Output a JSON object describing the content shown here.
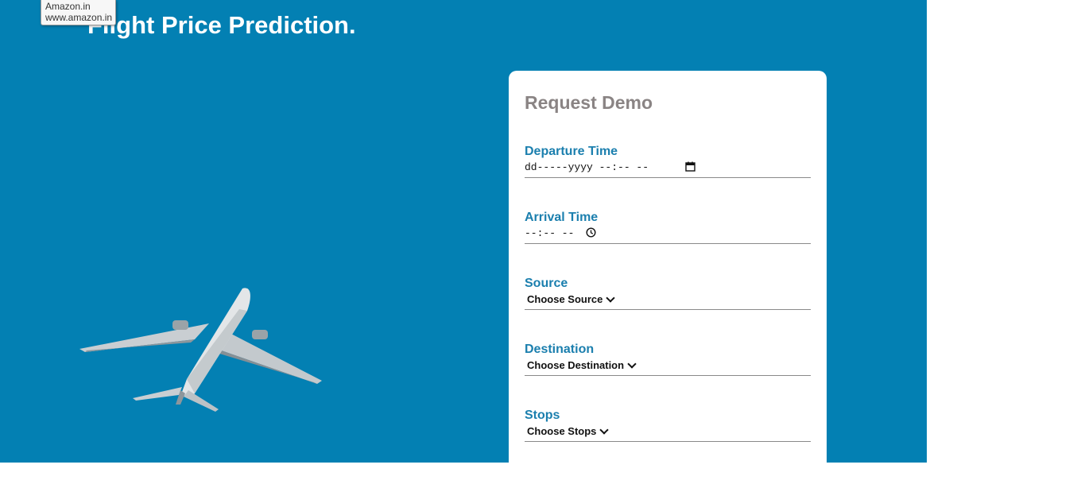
{
  "page": {
    "title": "Flight Price Prediction."
  },
  "tooltip": {
    "line1": "Amazon.in",
    "line2": "www.amazon.in"
  },
  "form": {
    "title": "Request Demo",
    "departure": {
      "label": "Departure Time",
      "value": "dd-----yyyy --:-- --",
      "icon": "calendar-icon"
    },
    "arrival": {
      "label": "Arrival Time",
      "value": "--:-- --",
      "icon": "clock-icon"
    },
    "source": {
      "label": "Source",
      "selected": "Choose Source"
    },
    "destination": {
      "label": "Destination",
      "selected": "Choose Destination"
    },
    "stops": {
      "label": "Stops",
      "selected": "Choose Stops"
    }
  },
  "colors": {
    "hero_bg": "#0380b3",
    "label": "#1b7fae",
    "card_title": "#8a8484"
  }
}
